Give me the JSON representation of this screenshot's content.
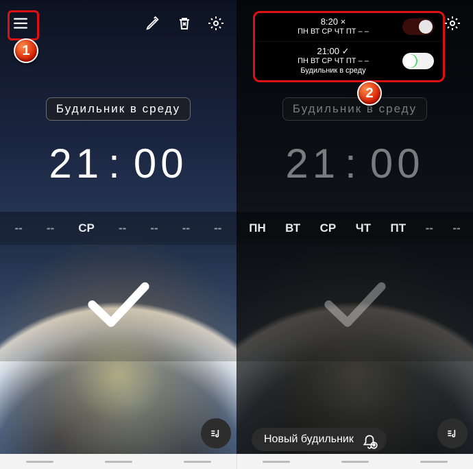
{
  "markers": {
    "one": "1",
    "two": "2"
  },
  "screen1": {
    "alarm_label": "Будильник  в  среду",
    "time_h": "21",
    "time_m": "00",
    "days": [
      "--",
      "--",
      "СР",
      "--",
      "--",
      "--",
      "--"
    ]
  },
  "screen2": {
    "alarm_label": "Будильник  в  среду",
    "time_h": "21",
    "time_m": "00",
    "days": [
      "ПН",
      "ВТ",
      "СР",
      "ЧТ",
      "ПТ",
      "--",
      "--"
    ],
    "panel": {
      "rows": [
        {
          "time": "8:20  ×",
          "days": "ПН ВТ СР ЧТ ПТ – –",
          "sub": "",
          "on": false
        },
        {
          "time": "21:00  ✓",
          "days": "ПН ВТ СР ЧТ ПТ – –",
          "sub": "Будильник в среду",
          "on": true
        }
      ]
    },
    "new_alarm": "Новый будильник"
  }
}
